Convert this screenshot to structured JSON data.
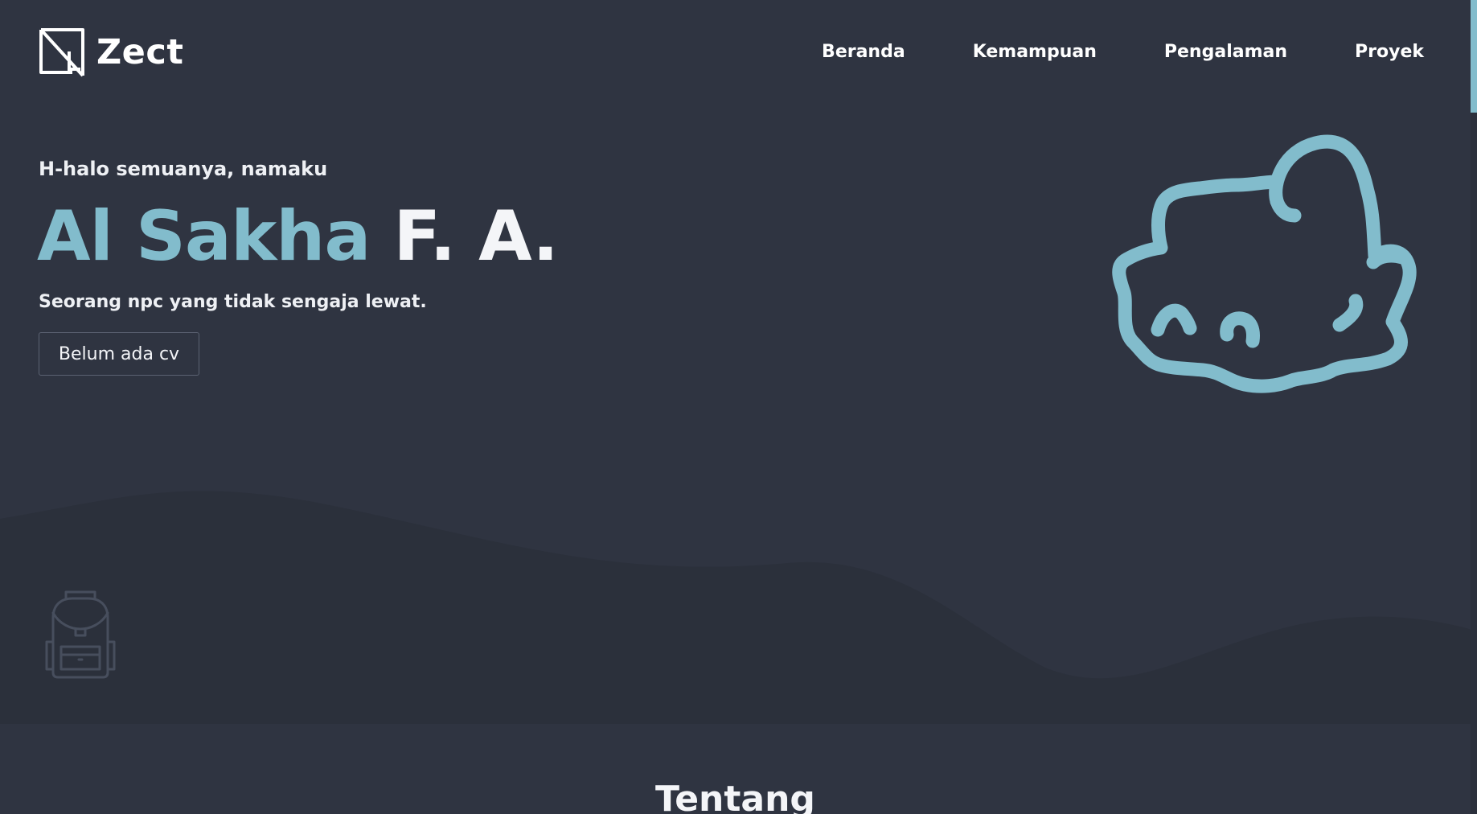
{
  "header": {
    "logo_text": "Zect",
    "nav": [
      {
        "label": "Beranda"
      },
      {
        "label": "Kemampuan"
      },
      {
        "label": "Pengalaman"
      },
      {
        "label": "Proyek"
      }
    ]
  },
  "hero": {
    "greeting": "H-halo semuanya, namaku",
    "name_accent": "Al Sakha",
    "name_rest": "F. A.",
    "tagline": "Seorang npc yang tidak sengaja lewat.",
    "cv_button_label": "Belum ada cv"
  },
  "about": {
    "title": "Tentang"
  },
  "icons": {
    "logo": "zect-logo-icon",
    "mascot": "cloud-face-mascot-icon",
    "backpack": "backpack-icon"
  },
  "colors": {
    "background": "#2f3441",
    "wave": "#2b303b",
    "accent": "#82bccc",
    "text": "#f4f5f8"
  }
}
